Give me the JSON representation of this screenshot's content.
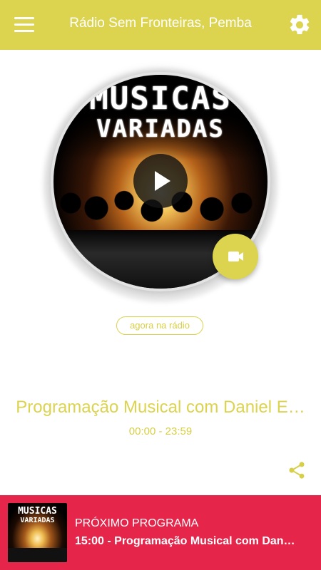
{
  "header": {
    "title": "Rádio Sem Fronteiras, Pemba",
    "menu_icon": "hamburger-menu-icon",
    "settings_icon": "gear-icon",
    "background_color": "#dcd34f"
  },
  "cover": {
    "line1": "MUSICAS",
    "line2": "VARIADAS",
    "play_icon": "play-icon",
    "video_icon": "video-camera-icon"
  },
  "now": {
    "badge": "agora na rádio",
    "program_title": "Programação Musical com Daniel E…",
    "time_range": "00:00 - 23:59",
    "share_icon": "share-icon",
    "accent_color": "#dcd34f"
  },
  "next": {
    "label": "PRÓXIMO PROGRAMA",
    "title": "15:00 - Programação Musical com Dan…",
    "thumb_line1": "MUSICAS",
    "thumb_line2": "VARIADAS",
    "background_color": "#e5264a"
  }
}
